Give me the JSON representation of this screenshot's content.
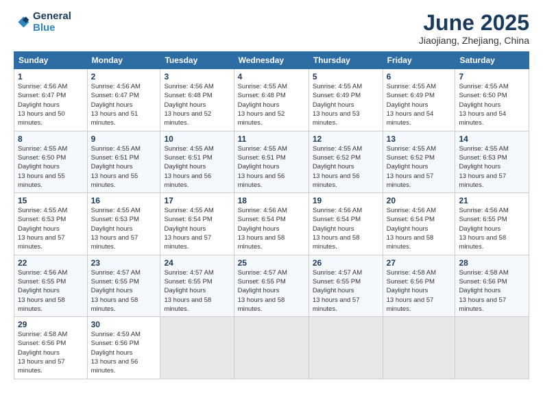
{
  "header": {
    "logo_line1": "General",
    "logo_line2": "Blue",
    "month": "June 2025",
    "location": "Jiaojiang, Zhejiang, China"
  },
  "weekdays": [
    "Sunday",
    "Monday",
    "Tuesday",
    "Wednesday",
    "Thursday",
    "Friday",
    "Saturday"
  ],
  "weeks": [
    [
      {
        "day": "1",
        "rise": "4:56 AM",
        "set": "6:47 PM",
        "hours": "13 hours and 50 minutes."
      },
      {
        "day": "2",
        "rise": "4:56 AM",
        "set": "6:47 PM",
        "hours": "13 hours and 51 minutes."
      },
      {
        "day": "3",
        "rise": "4:56 AM",
        "set": "6:48 PM",
        "hours": "13 hours and 52 minutes."
      },
      {
        "day": "4",
        "rise": "4:55 AM",
        "set": "6:48 PM",
        "hours": "13 hours and 52 minutes."
      },
      {
        "day": "5",
        "rise": "4:55 AM",
        "set": "6:49 PM",
        "hours": "13 hours and 53 minutes."
      },
      {
        "day": "6",
        "rise": "4:55 AM",
        "set": "6:49 PM",
        "hours": "13 hours and 54 minutes."
      },
      {
        "day": "7",
        "rise": "4:55 AM",
        "set": "6:50 PM",
        "hours": "13 hours and 54 minutes."
      }
    ],
    [
      {
        "day": "8",
        "rise": "4:55 AM",
        "set": "6:50 PM",
        "hours": "13 hours and 55 minutes."
      },
      {
        "day": "9",
        "rise": "4:55 AM",
        "set": "6:51 PM",
        "hours": "13 hours and 55 minutes."
      },
      {
        "day": "10",
        "rise": "4:55 AM",
        "set": "6:51 PM",
        "hours": "13 hours and 56 minutes."
      },
      {
        "day": "11",
        "rise": "4:55 AM",
        "set": "6:51 PM",
        "hours": "13 hours and 56 minutes."
      },
      {
        "day": "12",
        "rise": "4:55 AM",
        "set": "6:52 PM",
        "hours": "13 hours and 56 minutes."
      },
      {
        "day": "13",
        "rise": "4:55 AM",
        "set": "6:52 PM",
        "hours": "13 hours and 57 minutes."
      },
      {
        "day": "14",
        "rise": "4:55 AM",
        "set": "6:53 PM",
        "hours": "13 hours and 57 minutes."
      }
    ],
    [
      {
        "day": "15",
        "rise": "4:55 AM",
        "set": "6:53 PM",
        "hours": "13 hours and 57 minutes."
      },
      {
        "day": "16",
        "rise": "4:55 AM",
        "set": "6:53 PM",
        "hours": "13 hours and 57 minutes."
      },
      {
        "day": "17",
        "rise": "4:55 AM",
        "set": "6:54 PM",
        "hours": "13 hours and 57 minutes."
      },
      {
        "day": "18",
        "rise": "4:56 AM",
        "set": "6:54 PM",
        "hours": "13 hours and 58 minutes."
      },
      {
        "day": "19",
        "rise": "4:56 AM",
        "set": "6:54 PM",
        "hours": "13 hours and 58 minutes."
      },
      {
        "day": "20",
        "rise": "4:56 AM",
        "set": "6:54 PM",
        "hours": "13 hours and 58 minutes."
      },
      {
        "day": "21",
        "rise": "4:56 AM",
        "set": "6:55 PM",
        "hours": "13 hours and 58 minutes."
      }
    ],
    [
      {
        "day": "22",
        "rise": "4:56 AM",
        "set": "6:55 PM",
        "hours": "13 hours and 58 minutes."
      },
      {
        "day": "23",
        "rise": "4:57 AM",
        "set": "6:55 PM",
        "hours": "13 hours and 58 minutes."
      },
      {
        "day": "24",
        "rise": "4:57 AM",
        "set": "6:55 PM",
        "hours": "13 hours and 58 minutes."
      },
      {
        "day": "25",
        "rise": "4:57 AM",
        "set": "6:55 PM",
        "hours": "13 hours and 58 minutes."
      },
      {
        "day": "26",
        "rise": "4:57 AM",
        "set": "6:55 PM",
        "hours": "13 hours and 57 minutes."
      },
      {
        "day": "27",
        "rise": "4:58 AM",
        "set": "6:56 PM",
        "hours": "13 hours and 57 minutes."
      },
      {
        "day": "28",
        "rise": "4:58 AM",
        "set": "6:56 PM",
        "hours": "13 hours and 57 minutes."
      }
    ],
    [
      {
        "day": "29",
        "rise": "4:58 AM",
        "set": "6:56 PM",
        "hours": "13 hours and 57 minutes."
      },
      {
        "day": "30",
        "rise": "4:59 AM",
        "set": "6:56 PM",
        "hours": "13 hours and 56 minutes."
      },
      null,
      null,
      null,
      null,
      null
    ]
  ]
}
